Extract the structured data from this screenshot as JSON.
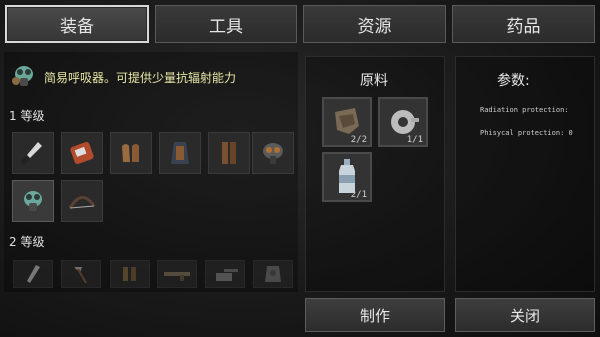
{
  "tabs": [
    {
      "label": "装备",
      "active": true
    },
    {
      "label": "工具",
      "active": false
    },
    {
      "label": "资源",
      "active": false
    },
    {
      "label": "药品",
      "active": false
    }
  ],
  "selected_item": {
    "icon": "gas-mask-icon",
    "description": "简易呼吸器。可提供少量抗辐射能力"
  },
  "levels": [
    {
      "label": "1 等级",
      "items": [
        {
          "icon": "knife-icon"
        },
        {
          "icon": "backpack-icon"
        },
        {
          "icon": "gloves-icon"
        },
        {
          "icon": "vest-icon"
        },
        {
          "icon": "leg-armor-icon"
        },
        {
          "icon": "gas-mask-icon"
        },
        {
          "icon": "respirator-icon",
          "selected": true
        },
        {
          "icon": "bow-icon"
        }
      ]
    },
    {
      "label": "2 等级",
      "items": [
        {
          "icon": "blade-icon"
        },
        {
          "icon": "axe-icon"
        },
        {
          "icon": "boots-icon"
        },
        {
          "icon": "rifle-icon"
        },
        {
          "icon": "turret-icon"
        },
        {
          "icon": "armor-icon"
        }
      ]
    }
  ],
  "materials": {
    "title": "原料",
    "items": [
      {
        "icon": "cloth-icon",
        "count": "2/2"
      },
      {
        "icon": "tape-icon",
        "count": "1/1"
      },
      {
        "icon": "bottle-icon",
        "count": "2/1"
      }
    ]
  },
  "params": {
    "title": "参数:",
    "lines": [
      "Radiation protection:",
      "Phisycal protection: 0"
    ]
  },
  "buttons": {
    "craft": "制作",
    "close": "关闭"
  },
  "colors": {
    "description": "#e8e8a6",
    "active_tab_border": "#d8d8d8"
  }
}
